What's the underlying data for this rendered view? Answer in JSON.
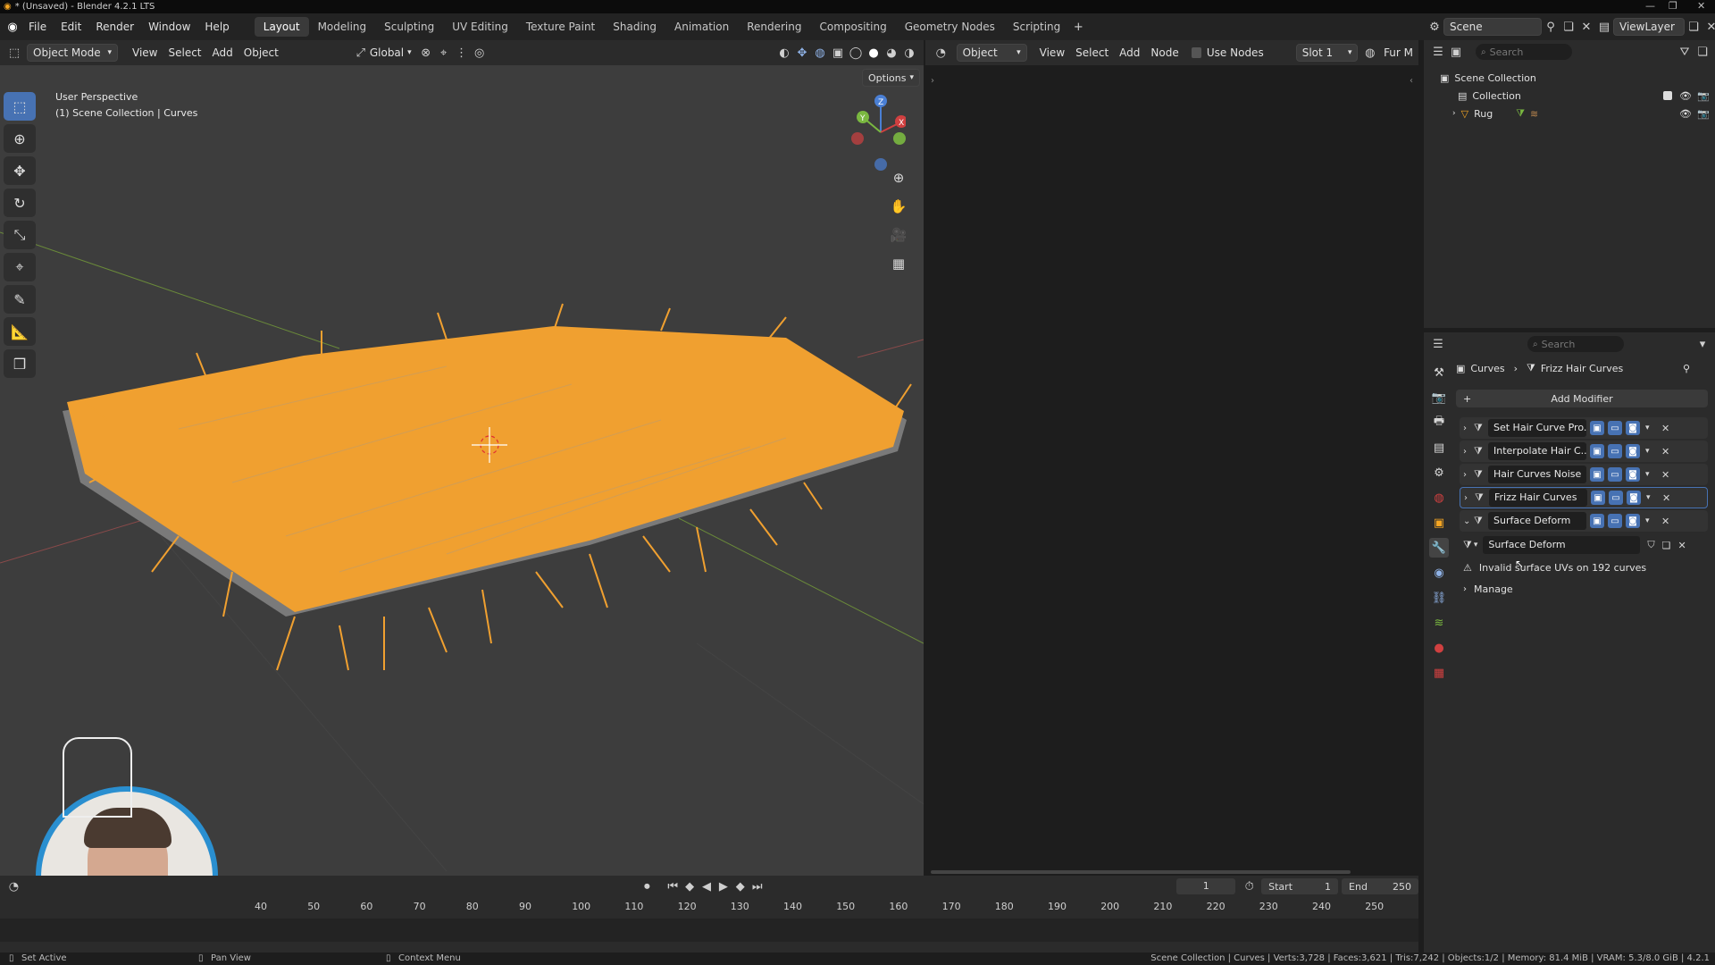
{
  "titlebar": {
    "text": "* (Unsaved) - Blender 4.2.1 LTS"
  },
  "menu": [
    "File",
    "Edit",
    "Render",
    "Window",
    "Help"
  ],
  "workspaces": [
    "Layout",
    "Modeling",
    "Sculpting",
    "UV Editing",
    "Texture Paint",
    "Shading",
    "Animation",
    "Rendering",
    "Compositing",
    "Geometry Nodes",
    "Scripting"
  ],
  "active_workspace": "Layout",
  "scene": {
    "name": "Scene",
    "view_layer": "ViewLayer"
  },
  "viewport_header": {
    "mode": "Object Mode",
    "menus": [
      "View",
      "Select",
      "Add",
      "Object"
    ],
    "orientation": "Global",
    "options": "Options"
  },
  "viewport": {
    "perspective": "User Perspective",
    "collection_info": "(1) Scene Collection | Curves",
    "axis_x": "X",
    "axis_y": "Y",
    "axis_z": "Z"
  },
  "shader_header": {
    "object": "Object",
    "menus": [
      "View",
      "Select",
      "Add",
      "Node"
    ],
    "use_nodes": "Use Nodes",
    "slot": "Slot 1",
    "material": "Fur M"
  },
  "outliner": {
    "search_placeholder": "Search",
    "items": [
      {
        "label": "Scene Collection"
      },
      {
        "label": "Collection"
      },
      {
        "label": "Rug"
      }
    ]
  },
  "properties": {
    "search_placeholder": "Search",
    "breadcrumb": {
      "object": "Curves",
      "modifier": "Frizz Hair Curves"
    },
    "add_modifier": "Add Modifier",
    "modifiers": [
      {
        "name": "Set Hair Curve Pro..."
      },
      {
        "name": "Interpolate Hair C..."
      },
      {
        "name": "Hair Curves Noise"
      },
      {
        "name": "Frizz Hair Curves"
      },
      {
        "name": "Surface Deform"
      }
    ],
    "node_group": "Surface Deform",
    "warning": "Invalid surface UVs on 192 curves",
    "manage": "Manage"
  },
  "timeline": {
    "current_frame": "1",
    "start_label": "Start",
    "start": "1",
    "end_label": "End",
    "end": "250",
    "ticks": [
      "40",
      "50",
      "60",
      "70",
      "80",
      "90",
      "100",
      "110",
      "120",
      "130",
      "140",
      "150",
      "160",
      "170",
      "180",
      "190",
      "200",
      "210",
      "220",
      "230",
      "240",
      "250"
    ]
  },
  "statusbar": {
    "left": [
      "Set Active",
      "Pan View",
      "Context Menu"
    ],
    "right": "Scene Collection | Curves | Verts:3,728 | Faces:3,621 | Tris:7,242 | Objects:1/2 | Memory: 81.4 MiB | VRAM: 5.3/8.0 GiB | 4.2.1"
  },
  "colors": {
    "accent": "#4772b3",
    "hair": "#f0a030",
    "selected_outline": "#f5a623"
  }
}
